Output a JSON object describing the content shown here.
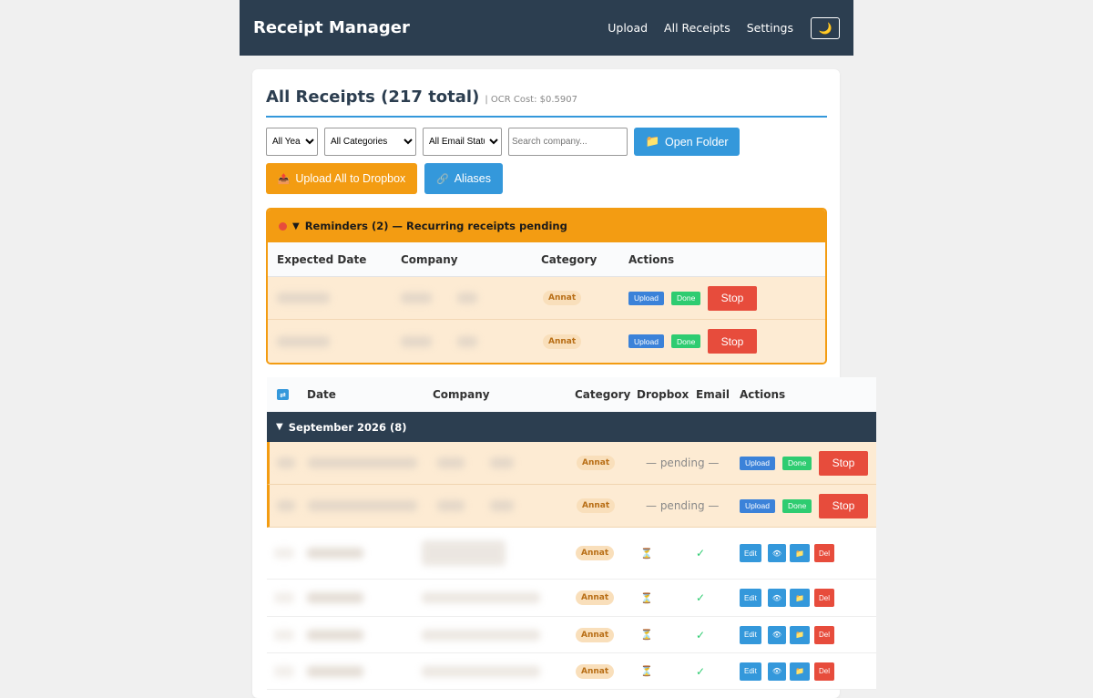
{
  "app": {
    "brand": "Receipt Manager"
  },
  "nav": {
    "upload": "Upload",
    "all_receipts": "All Receipts",
    "settings": "Settings",
    "theme_icon": "🌙"
  },
  "page": {
    "title": "All Receipts (217 total)",
    "subtitle": "| OCR Cost: $0.5907"
  },
  "filters": {
    "years": "All Years",
    "categories": "All Categories",
    "email_status": "All Email Status",
    "search_placeholder": "Search company...",
    "open_folder": "Open Folder",
    "upload_dropbox": "Upload All to Dropbox",
    "aliases": "Aliases"
  },
  "reminders": {
    "header": "Reminders (2) — Recurring receipts pending",
    "columns": [
      "Expected Date",
      "Company",
      "Category",
      "Actions"
    ],
    "rows": [
      {
        "category": "Annat",
        "upload": "Upload",
        "done": "Done",
        "stop": "Stop"
      },
      {
        "category": "Annat",
        "upload": "Upload",
        "done": "Done",
        "stop": "Stop"
      }
    ]
  },
  "table": {
    "columns": {
      "date": "Date",
      "company": "Company",
      "category": "Category",
      "dropbox": "Dropbox",
      "email": "Email",
      "actions": "Actions"
    },
    "month": "September 2026 (8)",
    "pending_rows": [
      {
        "category": "Annat",
        "status": "— pending —",
        "upload": "Upload",
        "done": "Done",
        "stop": "Stop"
      },
      {
        "category": "Annat",
        "status": "— pending —",
        "upload": "Upload",
        "done": "Done",
        "stop": "Stop"
      }
    ],
    "rows": [
      {
        "category": "Annat",
        "dropbox": "⏳",
        "email": "✓",
        "edit": "Edit",
        "view": "👁",
        "folder": "📁",
        "del": "Del"
      },
      {
        "category": "Annat",
        "dropbox": "⏳",
        "email": "✓",
        "edit": "Edit",
        "view": "👁",
        "folder": "📁",
        "del": "Del"
      },
      {
        "category": "Annat",
        "dropbox": "⏳",
        "email": "✓",
        "edit": "Edit",
        "view": "👁",
        "folder": "📁",
        "del": "Del"
      },
      {
        "category": "Annat",
        "dropbox": "⏳",
        "email": "✓",
        "edit": "Edit",
        "view": "👁",
        "folder": "📁",
        "del": "Del"
      }
    ]
  },
  "colors": {
    "navbar": "#2c3e50",
    "accent": "#3498db",
    "warning": "#f39c12",
    "danger": "#e74c3c",
    "success": "#2ecc71"
  }
}
